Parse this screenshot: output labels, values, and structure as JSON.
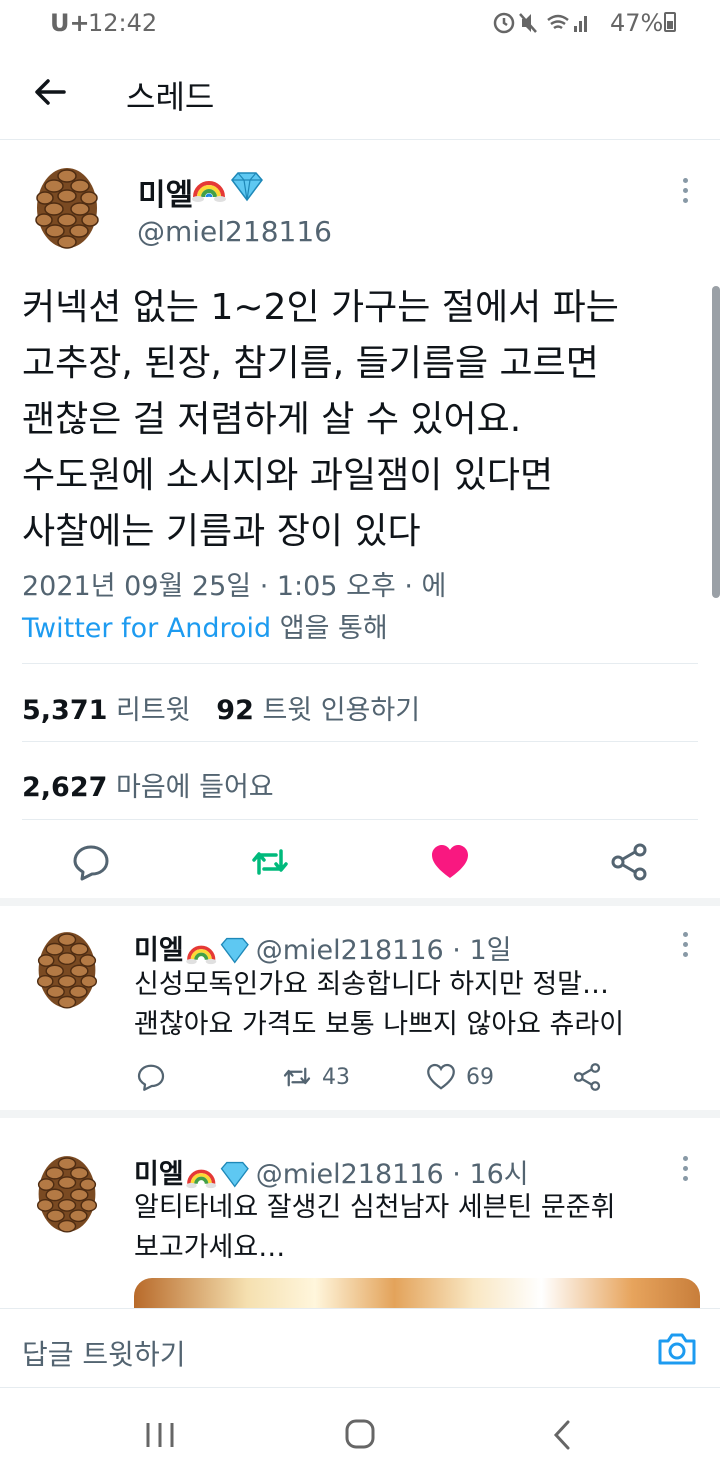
{
  "status_bar": {
    "carrier": "U+",
    "time": "12:42",
    "battery": "47%"
  },
  "app_bar": {
    "title": "스레드"
  },
  "main_tweet": {
    "name": "미엘",
    "handle": "@miel218116",
    "text": "커넥션 없는 1~2인 가구는 절에서 파는\n고추장, 된장, 참기름, 들기름을 고르면\n괜찮은 걸 저렴하게 살 수 있어요.\n수도원에 소시지와 과일잼이 있다면\n사찰에는 기름과 장이 있다",
    "timestamp": "2021년 09월 25일 · 1:05 오후 · 에",
    "source_link": "Twitter for Android",
    "source_suffix": " 앱을 통해",
    "retweet_count": "5,371",
    "retweet_label": "리트윗",
    "quote_count": "92",
    "quote_label": "트윗 인용하기",
    "like_count": "2,627",
    "like_label": "마음에 들어요"
  },
  "replies": [
    {
      "name": "미엘",
      "handle": "@miel218116",
      "time": "· 1일",
      "text": "신성모독인가요 죄송합니다 하지만 정말…\n괜찮아요 가격도 보통 나쁘지 않아요 츄라이",
      "retweets": "43",
      "likes": "69"
    },
    {
      "name": "미엘",
      "handle": "@miel218116",
      "time": "· 16시",
      "text": "알티타네요 잘생긴 심천남자 세븐틴 문준휘\n보고가세요…"
    }
  ],
  "compose": {
    "placeholder": "답글 트윗하기"
  },
  "colors": {
    "accent": "#1d9bf0",
    "retweet_green": "#00ba7c",
    "like_red": "#f91880",
    "secondary": "#536471"
  },
  "icons": [
    "back-arrow-icon",
    "kebab-icon",
    "reply-icon",
    "retweet-icon",
    "heart-icon",
    "share-icon",
    "camera-icon",
    "recent-apps-icon",
    "home-icon",
    "nav-back-icon"
  ]
}
